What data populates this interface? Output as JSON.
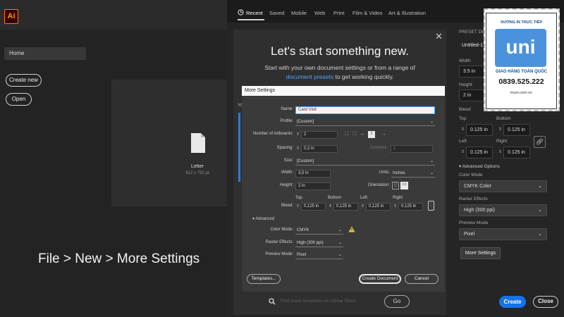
{
  "home": {
    "app_logo": "Ai",
    "nav_home": "Home",
    "create_new": "Create new",
    "open": "Open",
    "recent_doc_name": "Letter",
    "recent_doc_size": "612 x 792 pt"
  },
  "caption": "File > New > More Settings",
  "tabs": [
    "Recent",
    "Saved",
    "Mobile",
    "Web",
    "Print",
    "Film & Video",
    "Art & Illustration"
  ],
  "intro": {
    "title": "Let's start something new.",
    "subtitle_line1": "Start with your own document settings or from a range of",
    "presets_link": "document presets",
    "subtitle_line2_rest": " to get working quickly.",
    "section_label": "YO",
    "search_placeholder": "Find more templates on Adobe Stock",
    "go_button": "Go"
  },
  "preset_details": {
    "title": "PRESET DETAILS",
    "doc_name": "Untitled-1",
    "width_label": "Width",
    "width_value": "3.5 in",
    "height_label": "Height",
    "height_value": "2 in",
    "bleed_label": "Bleed",
    "top_label": "Top",
    "top_value": "0.125 in",
    "bottom_label": "Bottom",
    "bottom_value": "0.125 in",
    "left_label": "Left",
    "left_value": "0.125 in",
    "right_label": "Right",
    "right_value": "0.125 in",
    "advanced_options": "Advanced Options",
    "color_mode_label": "Color Mode",
    "color_mode_value": "CMYK Color",
    "raster_label": "Raster Effects",
    "raster_value": "High (300 ppi)",
    "preview_label": "Preview Mode",
    "preview_value": "Pixel",
    "more_settings_button": "More Settings",
    "create_button": "Create",
    "close_button": "Close"
  },
  "more_settings": {
    "header": "More Settings",
    "name_label": "Name:",
    "name_value": "Card Visit",
    "profile_label": "Profile:",
    "profile_value": "[Custom]",
    "artboards_label": "Number of Artboards:",
    "artboards_value": "2",
    "spacing_label": "Spacing:",
    "spacing_value": "0,2 in",
    "columns_label": "Columns:",
    "columns_value": "1",
    "size_label": "Size:",
    "size_value": "[Custom]",
    "width_label": "Width:",
    "width_value": "3,5 in",
    "units_label": "Units:",
    "units_value": "Inches",
    "height_label": "Height:",
    "height_value": "2 in",
    "orientation_label": "Orientation:",
    "bleed_label": "Bleed:",
    "top_label": "Top",
    "top_value": "0,125 in",
    "bottom_label": "Bottom",
    "bottom_value": "0,125 in",
    "left_label": "Left",
    "left_value": "0,125 in",
    "right_label": "Right",
    "right_value": "0,125 in",
    "advanced_label": "Advanced",
    "color_mode_label": "Color Mode:",
    "color_mode_value": "CMYK",
    "raster_label": "Raster Effects:",
    "raster_value": "High (300 ppi)",
    "preview_label": "Preview Mode:",
    "preview_value": "Pixel",
    "templates_button": "Templates...",
    "create_button": "Create Document",
    "cancel_button": "Cancel"
  },
  "stamp": {
    "line1": "XƯỞNG IN TRỰC TIẾP",
    "logo": "uni",
    "line2": "GIAO HÀNG TOÀN QUỐC",
    "phone": "0839.525.222",
    "web": "inuni.com.vn"
  },
  "colors": {
    "accent_blue": "#1473e6",
    "link_blue": "#4aa6ff",
    "warning_yellow": "#e8c23a",
    "ai_orange": "#ff9a00"
  }
}
